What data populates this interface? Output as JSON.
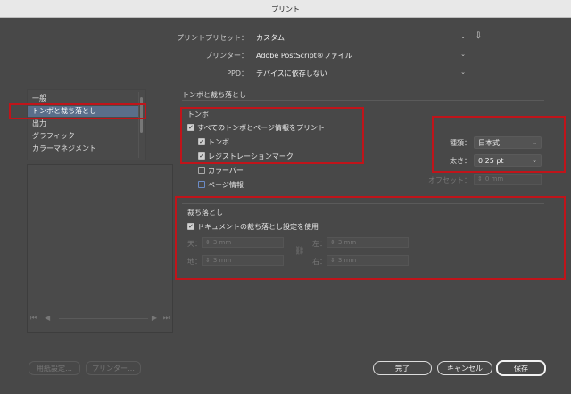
{
  "window": {
    "title": "プリント"
  },
  "top": {
    "preset_label": "プリントプリセット：",
    "preset_value": "カスタム",
    "printer_label": "プリンター：",
    "printer_value": "Adobe PostScript®ファイル",
    "ppd_label": "PPD：",
    "ppd_value": "デバイスに依存しない"
  },
  "sidebar": {
    "items": [
      {
        "label": "一般"
      },
      {
        "label": "トンボと裁ち落とし"
      },
      {
        "label": "出力"
      },
      {
        "label": "グラフィック"
      },
      {
        "label": "カラーマネジメント"
      }
    ],
    "selected_index": 1
  },
  "main": {
    "section_title": "トンボと裁ち落とし",
    "marks": {
      "group_label": "トンボ",
      "all_marks": "すべてのトンボとページ情報をプリント",
      "crop_marks": "トンボ",
      "registration_marks": "レジストレーションマーク",
      "color_bars": "カラーバー",
      "page_info": "ページ情報",
      "type_label": "種類：",
      "type_value": "日本式",
      "weight_label": "太さ：",
      "weight_value": "0.25 pt",
      "offset_label": "オフセット：",
      "offset_value": "0 mm"
    },
    "bleed": {
      "group_label": "裁ち落とし",
      "use_doc_bleed": "ドキュメントの裁ち落とし設定を使用",
      "top_label": "天：",
      "top_value": "3 mm",
      "bottom_label": "地：",
      "bottom_value": "3 mm",
      "left_label": "左：",
      "left_value": "3 mm",
      "right_label": "右：",
      "right_value": "3 mm"
    }
  },
  "buttons": {
    "page_setup": "用紙設定…",
    "printer": "プリンター…",
    "done": "完了",
    "cancel": "キャンセル",
    "save": "保存"
  },
  "colors": {
    "highlight": "#c0141a",
    "selected_item": "#5a6e8a"
  }
}
